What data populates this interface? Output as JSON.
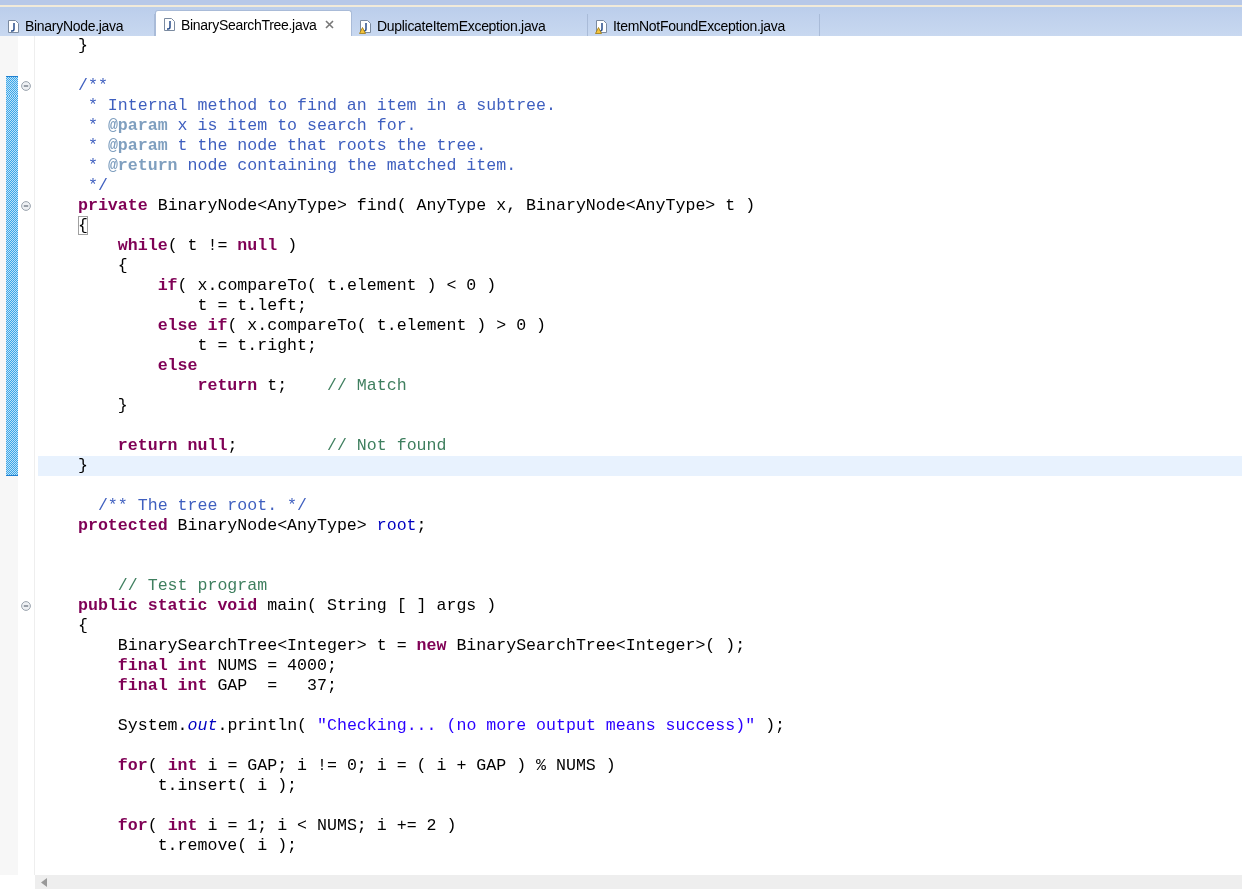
{
  "tabs": [
    {
      "label": "BinaryNode.java",
      "selected": false,
      "kind": "java"
    },
    {
      "label": "BinarySearchTree.java",
      "selected": true,
      "kind": "java"
    },
    {
      "label": "DuplicateItemException.java",
      "selected": false,
      "kind": "java-warning"
    },
    {
      "label": "ItemNotFoundException.java",
      "selected": false,
      "kind": "java-warning"
    }
  ],
  "editor": {
    "lines": [
      {
        "kind": "code",
        "tokens": [
          {
            "kind": "plain",
            "text": "}"
          }
        ]
      },
      {
        "kind": "blank"
      },
      {
        "kind": "code",
        "fold": true,
        "changed": true,
        "tokens": [
          {
            "kind": "javadoc",
            "text": "/**"
          }
        ]
      },
      {
        "kind": "code",
        "changed": true,
        "tokens": [
          {
            "kind": "javadoc",
            "text": " * Internal method to find an item in a subtree."
          }
        ]
      },
      {
        "kind": "code",
        "changed": true,
        "tokens": [
          {
            "kind": "javadoc",
            "text": " * "
          },
          {
            "kind": "javadoc-tag",
            "text": "@param"
          },
          {
            "kind": "javadoc",
            "text": " x is item to search for."
          }
        ]
      },
      {
        "kind": "code",
        "changed": true,
        "tokens": [
          {
            "kind": "javadoc",
            "text": " * "
          },
          {
            "kind": "javadoc-tag",
            "text": "@param"
          },
          {
            "kind": "javadoc",
            "text": " t the node that roots the tree."
          }
        ]
      },
      {
        "kind": "code",
        "changed": true,
        "tokens": [
          {
            "kind": "javadoc",
            "text": " * "
          },
          {
            "kind": "javadoc-tag",
            "text": "@return"
          },
          {
            "kind": "javadoc",
            "text": " node containing the matched item."
          }
        ]
      },
      {
        "kind": "code",
        "changed": true,
        "tokens": [
          {
            "kind": "javadoc",
            "text": " */"
          }
        ]
      },
      {
        "kind": "code",
        "fold": true,
        "changed": true,
        "tokens": [
          {
            "kind": "keyword",
            "text": "private"
          },
          {
            "kind": "plain",
            "text": " BinaryNode<AnyType> find( AnyType x, BinaryNode<AnyType> t )"
          }
        ]
      },
      {
        "kind": "code",
        "changed": true,
        "tokens": [
          {
            "kind": "bracket-match",
            "text": "{"
          }
        ]
      },
      {
        "kind": "code",
        "changed": true,
        "tokens": [
          {
            "kind": "keyword",
            "text": "    while"
          },
          {
            "kind": "plain",
            "text": "( t != "
          },
          {
            "kind": "keyword",
            "text": "null"
          },
          {
            "kind": "plain",
            "text": " )"
          }
        ]
      },
      {
        "kind": "code",
        "changed": true,
        "tokens": [
          {
            "kind": "plain",
            "text": "    {"
          }
        ]
      },
      {
        "kind": "code",
        "changed": true,
        "tokens": [
          {
            "kind": "keyword",
            "text": "        if"
          },
          {
            "kind": "plain",
            "text": "( x.compareTo( t.element ) < 0 )"
          }
        ]
      },
      {
        "kind": "code",
        "changed": true,
        "tokens": [
          {
            "kind": "plain",
            "text": "            t = t.left;"
          }
        ]
      },
      {
        "kind": "code",
        "changed": true,
        "tokens": [
          {
            "kind": "keyword",
            "text": "        else if"
          },
          {
            "kind": "plain",
            "text": "( x.compareTo( t.element ) > 0 )"
          }
        ]
      },
      {
        "kind": "code",
        "changed": true,
        "tokens": [
          {
            "kind": "plain",
            "text": "            t = t.right;"
          }
        ]
      },
      {
        "kind": "code",
        "changed": true,
        "tokens": [
          {
            "kind": "keyword",
            "text": "        else"
          }
        ]
      },
      {
        "kind": "code",
        "changed": true,
        "tokens": [
          {
            "kind": "keyword",
            "text": "            return"
          },
          {
            "kind": "plain",
            "text": " t;    "
          },
          {
            "kind": "comment",
            "text": "// Match"
          }
        ]
      },
      {
        "kind": "code",
        "changed": true,
        "tokens": [
          {
            "kind": "plain",
            "text": "    }"
          }
        ]
      },
      {
        "kind": "blank",
        "changed": true
      },
      {
        "kind": "code",
        "changed": true,
        "tokens": [
          {
            "kind": "keyword",
            "text": "    return null"
          },
          {
            "kind": "plain",
            "text": ";         "
          },
          {
            "kind": "comment",
            "text": "// Not found"
          }
        ]
      },
      {
        "kind": "code",
        "changed": true,
        "current": true,
        "tokens": [
          {
            "kind": "plain",
            "text": "}"
          }
        ]
      },
      {
        "kind": "blank"
      },
      {
        "kind": "code",
        "tokens": [
          {
            "kind": "javadoc",
            "text": "  /** The tree root. */"
          }
        ]
      },
      {
        "kind": "code",
        "tokens": [
          {
            "kind": "keyword",
            "text": "protected"
          },
          {
            "kind": "plain",
            "text": " BinaryNode<AnyType> "
          },
          {
            "kind": "field",
            "text": "root"
          },
          {
            "kind": "plain",
            "text": ";"
          }
        ]
      },
      {
        "kind": "blank"
      },
      {
        "kind": "blank"
      },
      {
        "kind": "code",
        "tokens": [
          {
            "kind": "comment",
            "text": "    // Test program"
          }
        ]
      },
      {
        "kind": "code",
        "fold": true,
        "tokens": [
          {
            "kind": "keyword",
            "text": "public static void"
          },
          {
            "kind": "plain",
            "text": " main( String [ ] args )"
          }
        ]
      },
      {
        "kind": "code",
        "tokens": [
          {
            "kind": "plain",
            "text": "{"
          }
        ]
      },
      {
        "kind": "code",
        "tokens": [
          {
            "kind": "plain",
            "text": "    BinarySearchTree<Integer> t = "
          },
          {
            "kind": "keyword",
            "text": "new"
          },
          {
            "kind": "plain",
            "text": " BinarySearchTree<Integer>( );"
          }
        ]
      },
      {
        "kind": "code",
        "tokens": [
          {
            "kind": "keyword",
            "text": "    final int"
          },
          {
            "kind": "plain",
            "text": " NUMS = 4000;"
          }
        ]
      },
      {
        "kind": "code",
        "tokens": [
          {
            "kind": "keyword",
            "text": "    final int"
          },
          {
            "kind": "plain",
            "text": " GAP  =   37;"
          }
        ]
      },
      {
        "kind": "blank"
      },
      {
        "kind": "code",
        "tokens": [
          {
            "kind": "plain",
            "text": "    System."
          },
          {
            "kind": "static-field",
            "text": "out"
          },
          {
            "kind": "plain",
            "text": ".println( "
          },
          {
            "kind": "string",
            "text": "\"Checking... (no more output means success)\""
          },
          {
            "kind": "plain",
            "text": " );"
          }
        ]
      },
      {
        "kind": "blank"
      },
      {
        "kind": "code",
        "tokens": [
          {
            "kind": "keyword",
            "text": "    for"
          },
          {
            "kind": "plain",
            "text": "( "
          },
          {
            "kind": "keyword",
            "text": "int"
          },
          {
            "kind": "plain",
            "text": " i = GAP; i != 0; i = ( i + GAP ) % NUMS )"
          }
        ]
      },
      {
        "kind": "code",
        "tokens": [
          {
            "kind": "plain",
            "text": "        t.insert( i );"
          }
        ]
      },
      {
        "kind": "blank"
      },
      {
        "kind": "code",
        "tokens": [
          {
            "kind": "keyword",
            "text": "    for"
          },
          {
            "kind": "plain",
            "text": "( "
          },
          {
            "kind": "keyword",
            "text": "int"
          },
          {
            "kind": "plain",
            "text": " i = 1; i < NUMS; i += 2 )"
          }
        ]
      },
      {
        "kind": "code",
        "tokens": [
          {
            "kind": "plain",
            "text": "        t.remove( i );"
          }
        ]
      }
    ]
  }
}
